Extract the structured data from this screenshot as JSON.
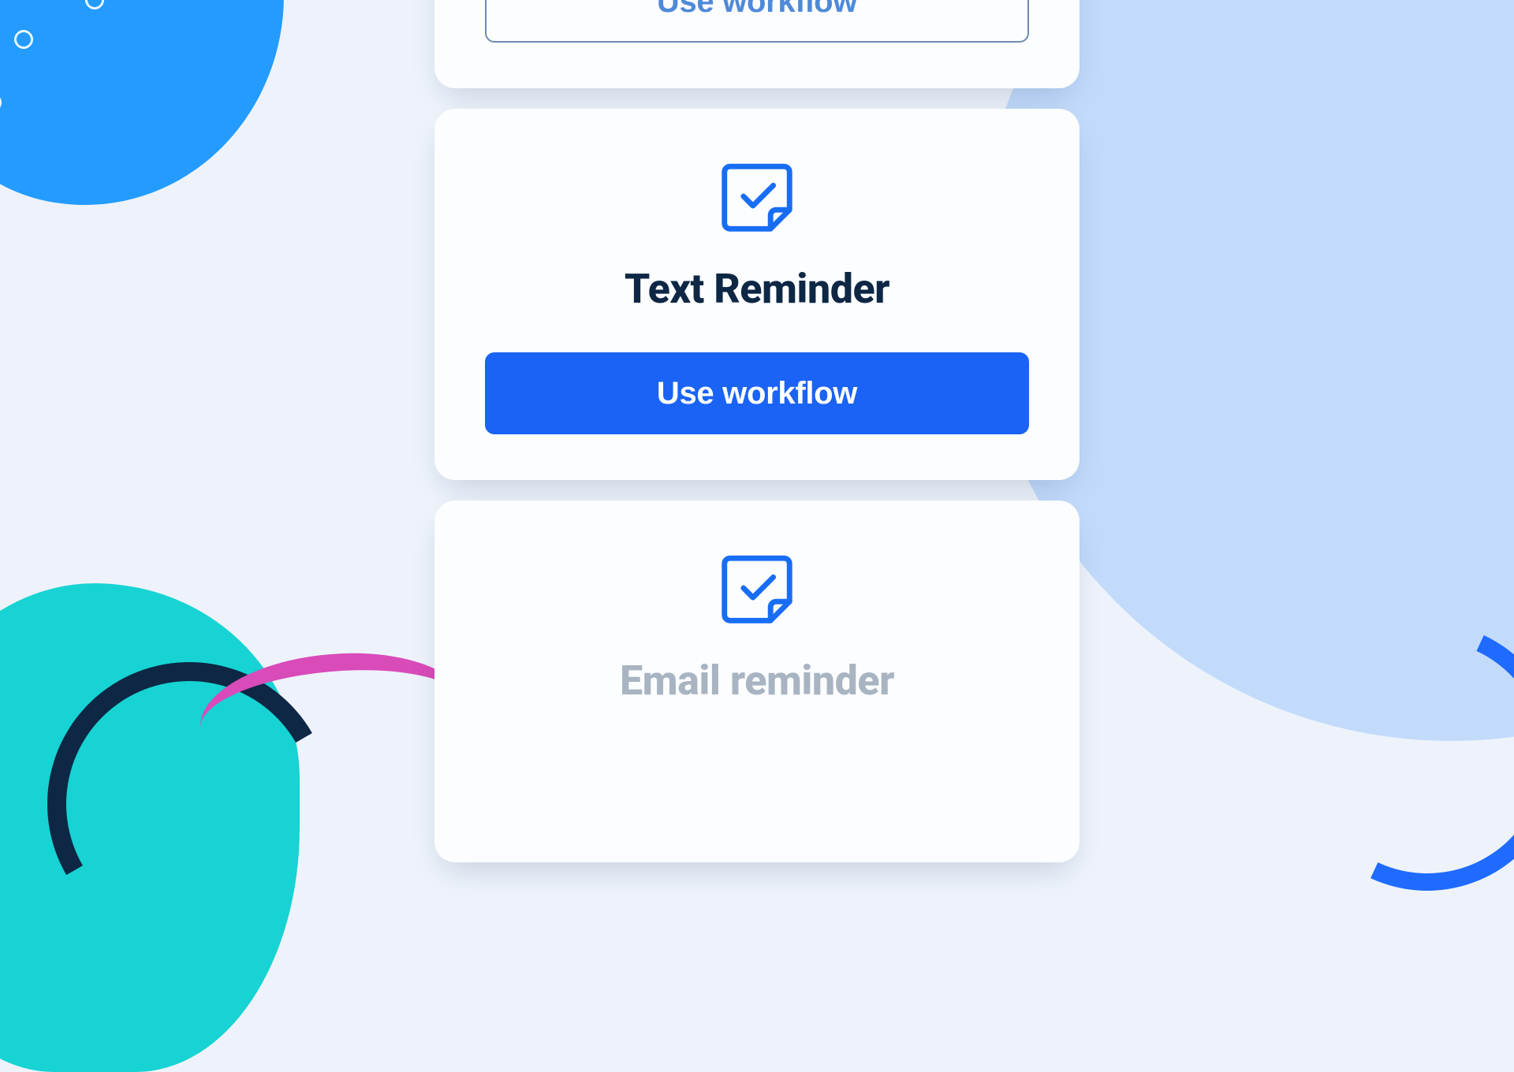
{
  "cards": [
    {
      "title": "",
      "button_label": "Use workflow",
      "button_style": "outline",
      "partial": "top"
    },
    {
      "title": "Text Reminder",
      "button_label": "Use workflow",
      "button_style": "primary"
    },
    {
      "title": "Email reminder",
      "button_label": "",
      "muted": true,
      "partial": "bottom"
    }
  ],
  "colors": {
    "primary": "#1a63f4",
    "icon_blue": "#186df5",
    "title_dark": "#0d2745",
    "title_muted": "#a8b4c2",
    "outline_text": "#4f8ad9",
    "bg": "#eef3fb"
  },
  "icon_name": "note-check-icon"
}
